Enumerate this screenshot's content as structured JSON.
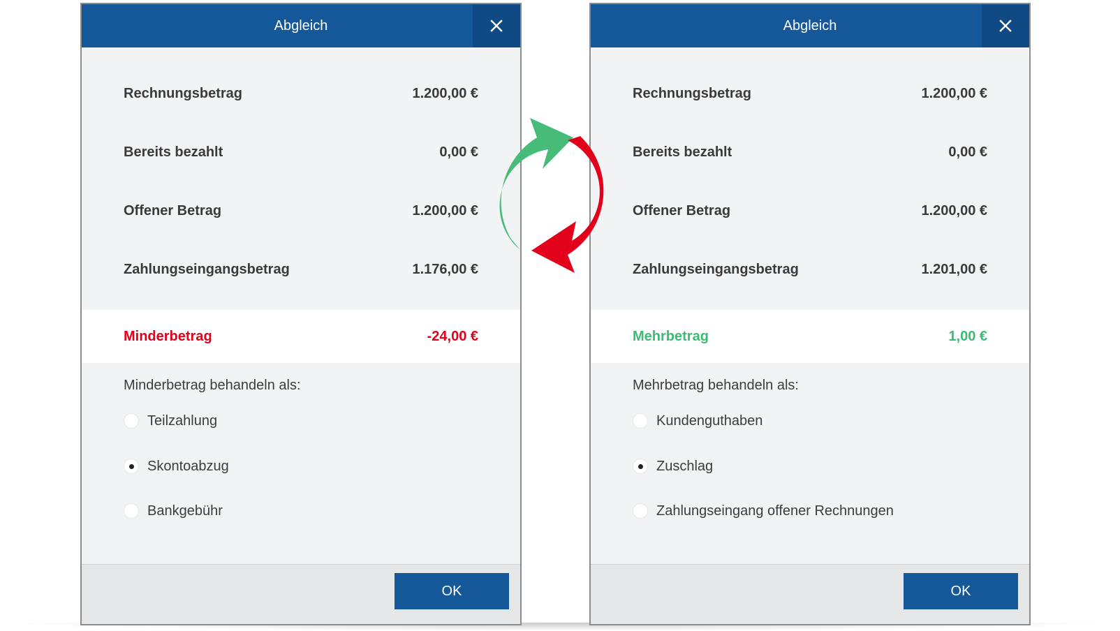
{
  "left_dialog": {
    "title": "Abgleich",
    "rows": [
      {
        "label": "Rechnungsbetrag",
        "value": "1.200,00 €"
      },
      {
        "label": "Bereits bezahlt",
        "value": "0,00 €"
      },
      {
        "label": "Offener Betrag",
        "value": "1.200,00 €"
      },
      {
        "label": "Zahlungseingangsbetrag",
        "value": "1.176,00 €"
      }
    ],
    "difference": {
      "label": "Minderbetrag",
      "value": "-24,00 €",
      "color": "#e2001a"
    },
    "treat_label": "Minderbetrag behandeln als:",
    "options": [
      {
        "label": "Teilzahlung",
        "selected": false
      },
      {
        "label": "Skontoabzug",
        "selected": true
      },
      {
        "label": "Bankgebühr",
        "selected": false
      }
    ],
    "ok_label": "OK"
  },
  "right_dialog": {
    "title": "Abgleich",
    "rows": [
      {
        "label": "Rechnungsbetrag",
        "value": "1.200,00 €"
      },
      {
        "label": "Bereits bezahlt",
        "value": "0,00 €"
      },
      {
        "label": "Offener Betrag",
        "value": "1.200,00 €"
      },
      {
        "label": "Zahlungseingangsbetrag",
        "value": "1.201,00 €"
      }
    ],
    "difference": {
      "label": "Mehrbetrag",
      "value": "1,00 €",
      "color": "#3dba73"
    },
    "treat_label": "Mehrbetrag behandeln als:",
    "options": [
      {
        "label": "Kundenguthaben",
        "selected": false
      },
      {
        "label": "Zuschlag",
        "selected": true
      },
      {
        "label": "Zahlungseingang offener Rechnungen",
        "selected": false
      }
    ],
    "ok_label": "OK"
  },
  "colors": {
    "header_blue": "#14589a",
    "close_blue": "#104a85",
    "arrow_green": "#47bb78",
    "arrow_red": "#e2001a"
  },
  "icons": {
    "close": "close-icon",
    "sync": "sync-arrows-icon"
  }
}
